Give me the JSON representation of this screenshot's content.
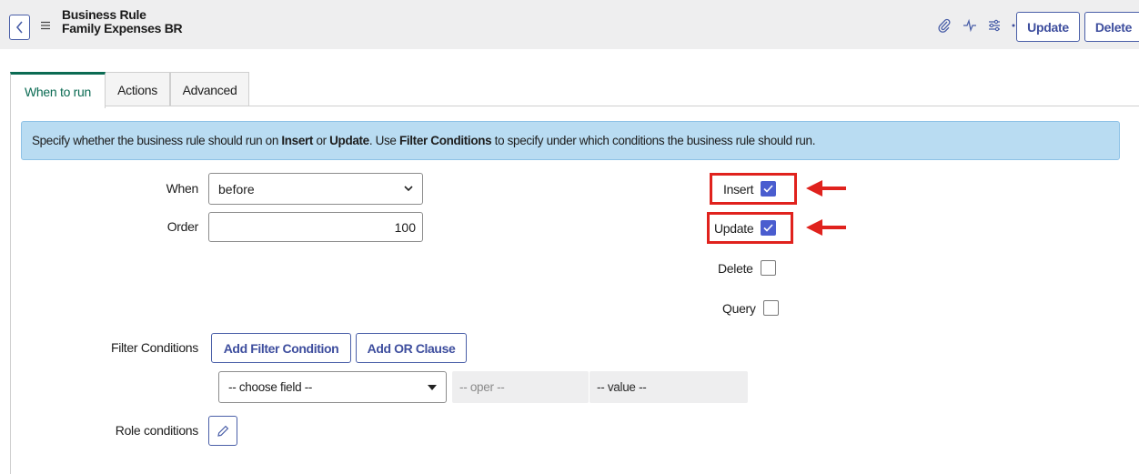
{
  "header": {
    "record_type": "Business Rule",
    "record_name": "Family Expenses BR",
    "update_label": "Update",
    "delete_label": "Delete",
    "icons": [
      "back-icon",
      "menu-icon",
      "paperclip-icon",
      "activity-icon",
      "settings-sliders-icon",
      "more-icon"
    ]
  },
  "tabs": [
    {
      "label": "When to run",
      "active": true
    },
    {
      "label": "Actions",
      "active": false
    },
    {
      "label": "Advanced",
      "active": false
    }
  ],
  "info": {
    "t1": "Specify whether the business rule should run on ",
    "b1": "Insert",
    "t2": " or ",
    "b2": "Update",
    "t3": ". Use ",
    "b3": "Filter Conditions",
    "t4": " to specify under which conditions the business rule should run."
  },
  "form": {
    "when_label": "When",
    "when_value": "before",
    "order_label": "Order",
    "order_value": "100",
    "filter_label": "Filter Conditions",
    "add_filter_label": "Add Filter Condition",
    "add_or_label": "Add OR Clause",
    "field_placeholder": "-- choose field --",
    "oper_placeholder": "-- oper --",
    "value_placeholder": "-- value --",
    "role_label": "Role conditions"
  },
  "checkboxes": [
    {
      "label": "Insert",
      "checked": true,
      "highlighted": true
    },
    {
      "label": "Update",
      "checked": true,
      "highlighted": true
    },
    {
      "label": "Delete",
      "checked": false,
      "highlighted": false
    },
    {
      "label": "Query",
      "checked": false,
      "highlighted": false
    }
  ],
  "colors": {
    "accent": "#4a5fa8",
    "active_tab": "#0b6b53",
    "info_bg": "#b9dcf2",
    "checkbox_checked": "#4a5dcf",
    "highlight_red": "#e0221d"
  }
}
